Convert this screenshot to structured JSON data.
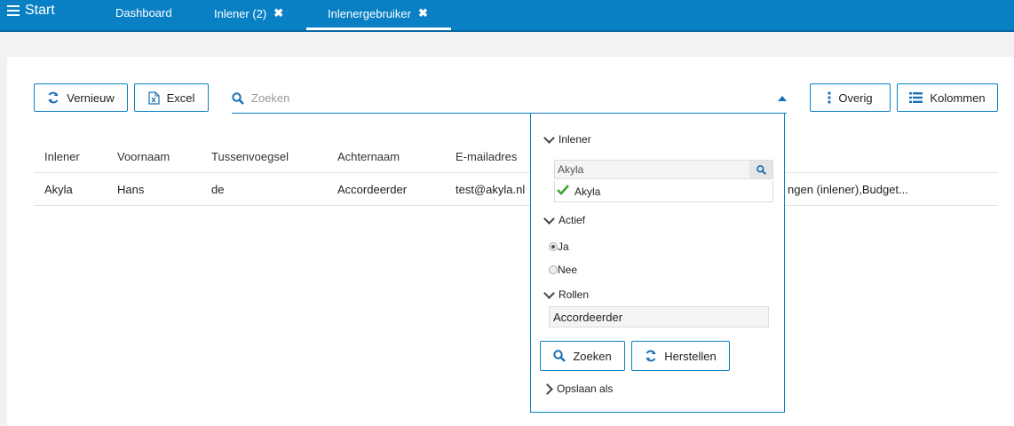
{
  "topbar": {
    "start_label": "Start",
    "tabs": [
      {
        "label": "Dashboard"
      },
      {
        "label": "Inlener (2)"
      },
      {
        "label": "Inlenergebruiker"
      }
    ],
    "close_glyph": "✖"
  },
  "toolbar": {
    "refresh_label": "Vernieuw",
    "excel_label": "Excel",
    "search_placeholder": "Zoeken",
    "more_label": "Overig",
    "columns_label": "Kolommen"
  },
  "table": {
    "headers": [
      "Inlener",
      "Voornaam",
      "Tussenvoegsel",
      "Achternaam",
      "E-mailadres"
    ],
    "rows": [
      {
        "inlener": "Akyla",
        "voornaam": "Hans",
        "tussenvoegsel": "de",
        "achternaam": "Accordeerder",
        "email": "test@akyla.nl",
        "rollen_truncated": "ngen (inlener),Budget..."
      }
    ]
  },
  "filter_panel": {
    "inlener_section": "Inlener",
    "inlener_search_value": "Akyla",
    "inlener_selected": "Akyla",
    "actief_section": "Actief",
    "actief_options": [
      "Ja",
      "Nee"
    ],
    "actief_selected": "Ja",
    "rollen_section": "Rollen",
    "rollen_value": "Accordeerder",
    "search_button": "Zoeken",
    "reset_button": "Herstellen",
    "save_as": "Opslaan als"
  },
  "colors": {
    "accent": "#0a80c4",
    "icon": "#1a6fb5",
    "check": "#3aa832"
  }
}
